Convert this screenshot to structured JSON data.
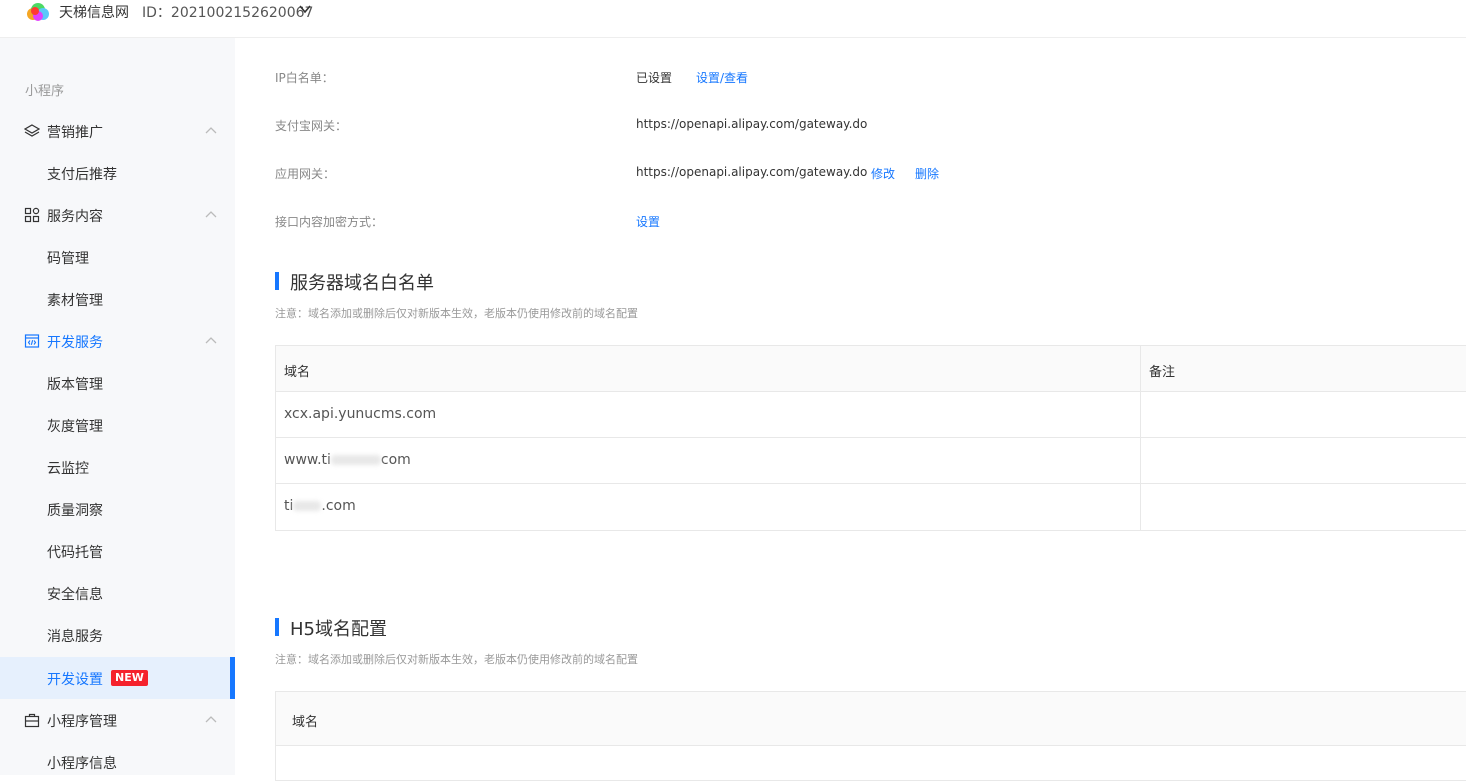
{
  "header": {
    "app_name": "天梯信息网",
    "app_id": "ID：2021002152620067",
    "logo_icon": "rainbow-cloud-logo"
  },
  "sidebar": {
    "section": "小程序",
    "groups": [
      {
        "label": "营销推广",
        "icon": "layers-icon",
        "items": [
          "支付后推荐"
        ]
      },
      {
        "label": "服务内容",
        "icon": "grid-icon",
        "items": [
          "码管理",
          "素材管理"
        ]
      },
      {
        "label": "开发服务",
        "icon": "code-window-icon",
        "active": true,
        "items": [
          "版本管理",
          "灰度管理",
          "云监控",
          "质量洞察",
          "代码托管",
          "安全信息",
          "消息服务",
          "开发设置"
        ]
      },
      {
        "label": "小程序管理",
        "icon": "briefcase-icon",
        "items": [
          "小程序信息"
        ]
      }
    ],
    "selected_item": "开发设置",
    "new_badge": "NEW"
  },
  "settings": {
    "ip_whitelist": {
      "label": "IP白名单：",
      "value": "已设置",
      "action": "设置/查看"
    },
    "alipay_gateway": {
      "label": "支付宝网关：",
      "value": "https://openapi.alipay.com/gateway.do"
    },
    "app_gateway": {
      "label": "应用网关：",
      "value": "https://openapi.alipay.com/gateway.do",
      "edit": "修改",
      "delete": "删除"
    },
    "encryption": {
      "label": "接口内容加密方式：",
      "action": "设置"
    }
  },
  "server_domains": {
    "title": "服务器域名白名单",
    "note": "注意：域名添加或删除后仅对新版本生效，老版本仍使用修改前的域名配置",
    "columns": [
      "域名",
      "备注"
    ],
    "rows": [
      {
        "domain": "xcx.api.yunucms.com",
        "remark": ""
      },
      {
        "domain_prefix": "www.ti",
        "domain_suffix": "com",
        "remark": ""
      },
      {
        "domain_prefix": "ti",
        "domain_suffix": ".com",
        "remark": ""
      }
    ]
  },
  "h5_domains": {
    "title": "H5域名配置",
    "note": "注意：域名添加或删除后仅对新版本生效，老版本仍使用修改前的域名配置",
    "columns": [
      "域名"
    ]
  },
  "colors": {
    "accent": "#1677ff",
    "badge": "#f5222d",
    "sidebar_bg": "#f7f8fa",
    "selected_bg": "#e6f0fd"
  }
}
